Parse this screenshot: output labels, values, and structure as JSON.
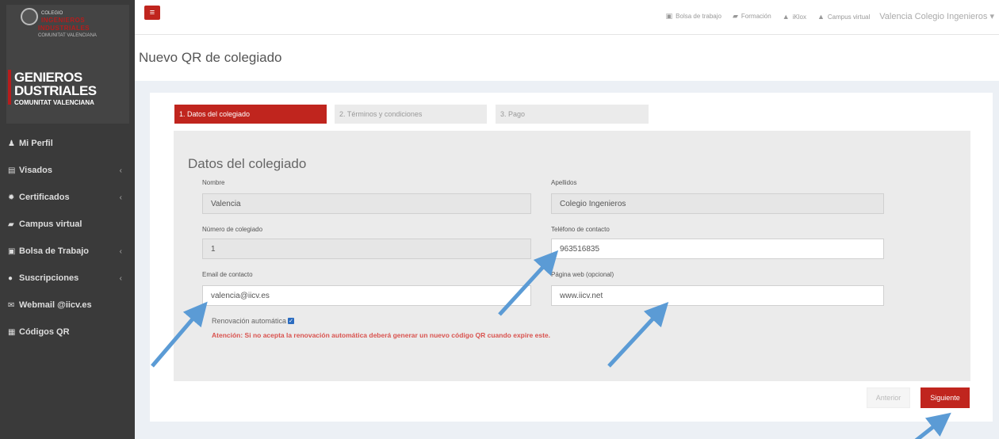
{
  "logo": {
    "small_text": "COLEGIO",
    "red_line1": "INGENIEROS",
    "red_line2": "INDUSTRIALES",
    "region": "COMUNITAT VALENCIANA",
    "big_line1": "GENIEROS",
    "big_line2": "DUSTRIALES",
    "big_line3": "COMUNITAT VALENCIANA"
  },
  "sidebar": {
    "items": [
      {
        "label": "Mi Perfil",
        "icon": "user-icon",
        "glyph": "♟",
        "chevron": false
      },
      {
        "label": "Visados",
        "icon": "file-icon",
        "glyph": "▤",
        "chevron": true
      },
      {
        "label": "Certificados",
        "icon": "certificate-icon",
        "glyph": "✹",
        "chevron": true
      },
      {
        "label": "Campus virtual",
        "icon": "book-icon",
        "glyph": "▰",
        "chevron": false
      },
      {
        "label": "Bolsa de Trabajo",
        "icon": "briefcase-icon",
        "glyph": "▣",
        "chevron": true
      },
      {
        "label": "Suscripciones",
        "icon": "comment-icon",
        "glyph": "●",
        "chevron": true
      },
      {
        "label": "Webmail @iicv.es",
        "icon": "envelope-icon",
        "glyph": "✉",
        "chevron": false
      },
      {
        "label": "Códigos QR",
        "icon": "qrcode-icon",
        "glyph": "▦",
        "chevron": false
      }
    ]
  },
  "topbar": {
    "links": [
      {
        "label": "Bolsa de trabajo",
        "icon": "briefcase-icon",
        "glyph": "▣"
      },
      {
        "label": "Formación",
        "icon": "book-icon",
        "glyph": "▰"
      },
      {
        "label": "iKlox",
        "icon": "graduation-cap-icon",
        "glyph": "▲"
      },
      {
        "label": "Campus virtual",
        "icon": "graduation-cap-icon",
        "glyph": "▲"
      }
    ],
    "user": "Valencia Colegio Ingenieros ▾"
  },
  "page": {
    "title": "Nuevo QR de colegiado"
  },
  "steps": [
    {
      "label": "1. Datos del colegiado",
      "active": true
    },
    {
      "label": "2. Términos y condiciones",
      "active": false
    },
    {
      "label": "3. Pago",
      "active": false
    }
  ],
  "form": {
    "heading": "Datos del colegiado",
    "nombre_label": "Nombre",
    "nombre_value": "Valencia",
    "apellidos_label": "Apellidos",
    "apellidos_value": "Colegio Ingenieros",
    "numero_label": "Número de colegiado",
    "numero_value": "1",
    "telefono_label": "Teléfono de contacto",
    "telefono_value": "963516835",
    "email_label": "Email de contacto",
    "email_value": "valencia@iicv.es",
    "web_label": "Página web (opcional)",
    "web_value": "www.iicv.net",
    "renovacion_label": "Renovación automática",
    "renovacion_checked": true,
    "warning": "Atención: Si no acepta la renovación automática deberá generar un nuevo código QR cuando expire este."
  },
  "buttons": {
    "prev": "Anterior",
    "next": "Siguiente"
  },
  "colors": {
    "accent": "#c0251e",
    "sidebar": "#3a3a3a",
    "arrow": "#5b9bd5"
  }
}
